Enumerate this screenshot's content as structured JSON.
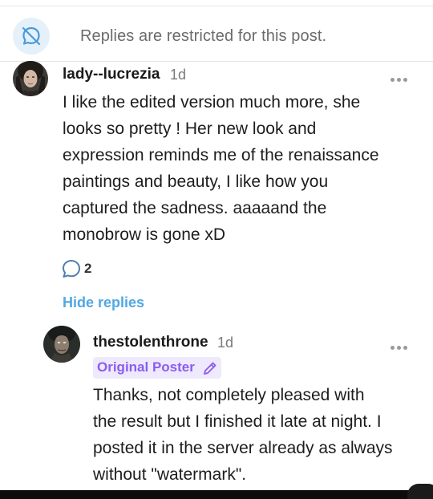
{
  "restricted_notice": {
    "text": "Replies are restricted for this post.",
    "icon": "no-reply-icon"
  },
  "comments": [
    {
      "username": "lady--lucrezia",
      "time": "1d",
      "lines": [
        "I like the edited version much more, she",
        "looks so pretty ! Her new look and",
        "expression reminds me of the renaissance",
        "paintings and beauty, I like how you",
        "captured the sadness. aaaaand the",
        "monobrow is gone xD"
      ],
      "reply_count": "2"
    }
  ],
  "hide_replies_label": "Hide replies",
  "replies": [
    {
      "username": "thestolenthrone",
      "time": "1d",
      "badge": "Original Poster",
      "lines": [
        "Thanks, not completely pleased with",
        "the result but I finished it late at night. I",
        "posted it in the server already as always",
        "without \"watermark\"."
      ]
    }
  ],
  "colors": {
    "accent_blue": "#52a8e3",
    "op_purple": "#8a5cf0",
    "op_badge_bg": "#efe9fd",
    "notice_icon_bg": "#e4f1fb"
  }
}
